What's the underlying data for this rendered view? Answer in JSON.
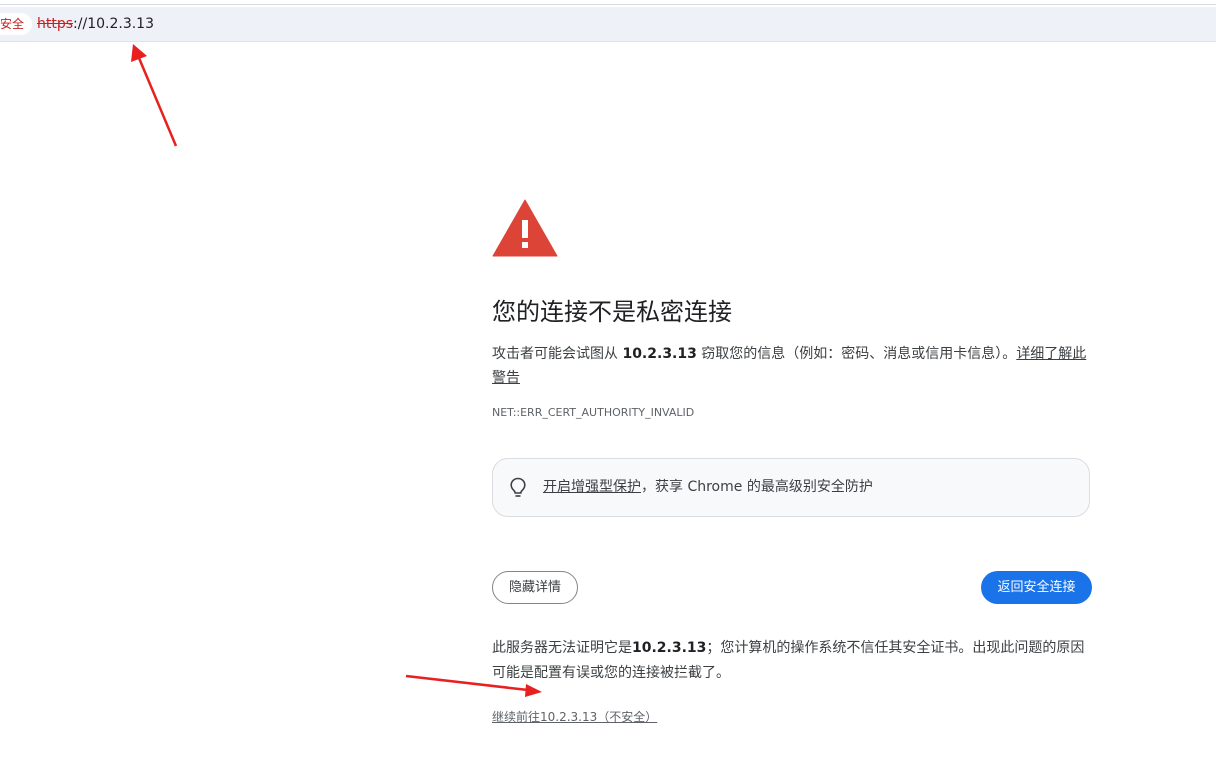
{
  "address_bar": {
    "security_chip": "安全",
    "url_scheme": "https",
    "url_rest": "://10.2.3.13"
  },
  "interstitial": {
    "heading": "您的连接不是私密连接",
    "desc_before": "攻击者可能会试图从 ",
    "desc_host": "10.2.3.13",
    "desc_after": " 窃取您的信息（例如：密码、消息或信用卡信息）。",
    "learn_more_link": "详细了解此警告",
    "error_code": "NET::ERR_CERT_AUTHORITY_INVALID",
    "promo_link": "开启增强型保护",
    "promo_text": "，获享 Chrome 的最高级别安全防护",
    "hide_details_button": "隐藏详情",
    "back_button": "返回安全连接",
    "details_before": "此服务器无法证明它是",
    "details_host": "10.2.3.13",
    "details_after": "；您计算机的操作系统不信任其安全证书。出现此问题的原因可能是配置有误或您的连接被拦截了。",
    "proceed_link": "继续前往10.2.3.13（不安全）"
  },
  "colors": {
    "warning_red": "#db4437",
    "primary_blue": "#1a73e8",
    "annotation_arrow": "#e8201f"
  }
}
